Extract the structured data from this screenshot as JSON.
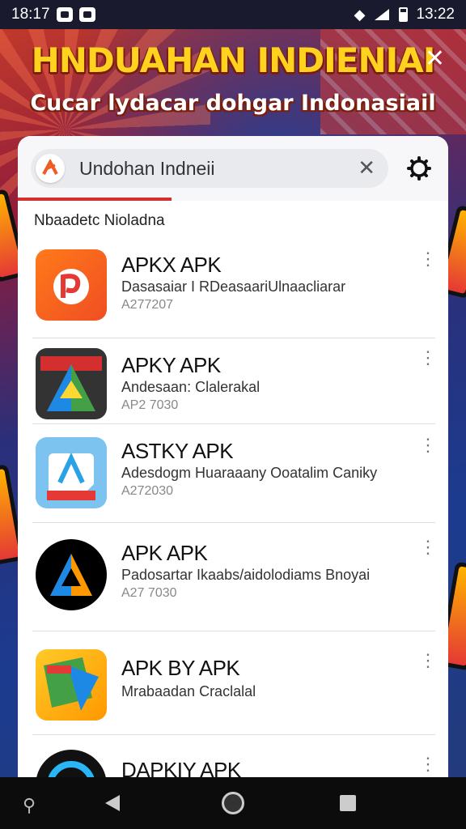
{
  "status_bar": {
    "time_left": "18:17",
    "time_right": "13:22"
  },
  "banner": {
    "title": "HNDUAHAN INDIENIAI",
    "subtitle": "Cucar lydacar dohgar Indonasiail",
    "close_glyph": "✕"
  },
  "search": {
    "value": "Undohan Indneii",
    "clear_glyph": "✕"
  },
  "section_label": "Nbaadetc Nioladna",
  "apps": [
    {
      "title": "APKX APK",
      "desc": "Dasasaiar I RDeasaariUlnaacliarar",
      "ver": "A277207",
      "icon": "orange-p-logo-icon"
    },
    {
      "title": "APKY APK",
      "desc": "Andesaan: Clalerakal",
      "ver": "AP2 7030",
      "icon": "colorful-a-logo-icon"
    },
    {
      "title": "ASTKY APK",
      "desc": "Adesdogm Huaraaany Ooatalim Caniky",
      "ver": "A272030",
      "icon": "blue-a-sticker-icon"
    },
    {
      "title": "APK APK",
      "desc": "Padosartar Ikaabs/aidolodiams Bnoyai",
      "ver": "A27 7030",
      "icon": "black-circle-a-logo-icon"
    },
    {
      "title": "APK BY APK",
      "desc": "Mrabaadan Craclalal",
      "ver": "",
      "icon": "yellow-play-logo-icon"
    },
    {
      "title": "DAPKIY APK",
      "desc": "",
      "ver": "",
      "icon": "dark-circle-logo-icon"
    }
  ],
  "colors": {
    "accent": "#d32f2f",
    "banner_title": "#ffd21f"
  }
}
